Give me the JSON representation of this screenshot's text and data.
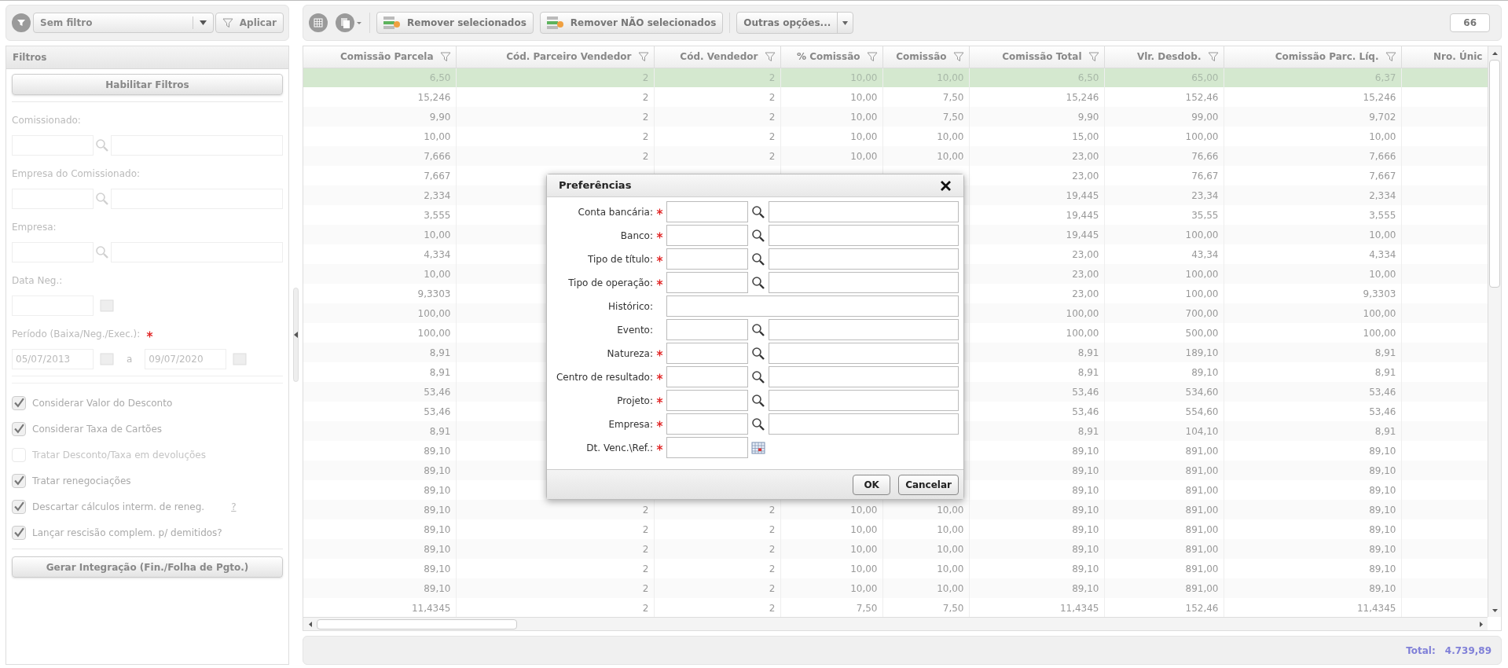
{
  "filter_bar": {
    "filter": "Sem filtro",
    "apply": "Aplicar"
  },
  "filters_panel": {
    "title": "Filtros",
    "enabled": false,
    "enable_button": "Habilitar Filtros",
    "fields": [
      {
        "label": "Comissionado:",
        "kind": "lookup"
      },
      {
        "label": "Empresa do Comissionado:",
        "kind": "lookup"
      },
      {
        "label": "Empresa:",
        "kind": "lookup"
      },
      {
        "label": "Data Neg.:",
        "kind": "date"
      },
      {
        "label": "Período (Baixa/Neg./Exec.):",
        "kind": "range",
        "required": true,
        "from": "05/07/2013",
        "separator": "a",
        "to": "09/07/2020"
      }
    ],
    "options": [
      {
        "label": "Considerar Valor do Desconto",
        "checked": true,
        "disabled": false
      },
      {
        "label": "Considerar Taxa de Cartões",
        "checked": true,
        "disabled": false
      },
      {
        "label": "Tratar Desconto/Taxa em devoluções",
        "checked": false,
        "disabled": true
      },
      {
        "label": "Tratar renegociações",
        "checked": true,
        "disabled": false
      },
      {
        "label": "Descartar cálculos interm. de reneg.",
        "checked": true,
        "disabled": false,
        "help": "?"
      },
      {
        "label": "Lançar rescisão complem. p/ demitidos?",
        "checked": true,
        "disabled": false
      }
    ],
    "action_button": "Gerar Integração (Fin./Folha de Pgto.)"
  },
  "toolbar": {
    "buttons": [
      "Remover selecionados",
      "Remover NÃO selecionados"
    ],
    "more": "Outras opções...",
    "count": "66"
  },
  "table": {
    "columns": [
      {
        "label": "Comissão Parcela",
        "filter": true
      },
      {
        "label": "Cód. Parceiro Vendedor",
        "filter": true
      },
      {
        "label": "Cód. Vendedor",
        "filter": true
      },
      {
        "label": "% Comissão",
        "filter": true
      },
      {
        "label": "Comissão",
        "filter": true
      },
      {
        "label": "Comissão Total",
        "filter": true
      },
      {
        "label": "Vlr. Desdob.",
        "filter": true
      },
      {
        "label": "Comissão Parc. Líq.",
        "filter": true
      },
      {
        "label": "Nro. Únic",
        "filter": false
      }
    ],
    "rows": [
      {
        "selected": true,
        "cells": [
          "6,50",
          "2",
          "2",
          "10,00",
          "10,00",
          "6,50",
          "65,00",
          "6,37",
          null
        ]
      },
      {
        "selected": false,
        "cells": [
          "15,246",
          "2",
          "2",
          "10,00",
          "7,50",
          "15,246",
          "152,46",
          "15,246",
          null
        ]
      },
      {
        "selected": false,
        "cells": [
          "9,90",
          "2",
          "2",
          "10,00",
          "7,50",
          "9,90",
          "99,00",
          "9,702",
          null
        ]
      },
      {
        "selected": false,
        "cells": [
          "10,00",
          "2",
          "2",
          "10,00",
          "10,00",
          "15,00",
          "100,00",
          "10,00",
          null
        ]
      },
      {
        "selected": false,
        "cells": [
          "7,666",
          "2",
          "2",
          "10,00",
          "10,00",
          "23,00",
          "76,66",
          "7,666",
          null
        ]
      },
      {
        "selected": false,
        "cells": [
          "7,667",
          null,
          null,
          null,
          null,
          "23,00",
          "76,67",
          "7,667",
          null
        ]
      },
      {
        "selected": false,
        "cells": [
          "2,334",
          null,
          null,
          null,
          null,
          "19,445",
          "23,34",
          "2,334",
          null
        ]
      },
      {
        "selected": false,
        "cells": [
          "3,555",
          null,
          null,
          null,
          null,
          "19,445",
          "35,55",
          "3,555",
          null
        ]
      },
      {
        "selected": false,
        "cells": [
          "10,00",
          null,
          null,
          null,
          null,
          "19,445",
          "100,00",
          "10,00",
          null
        ]
      },
      {
        "selected": false,
        "cells": [
          "4,334",
          null,
          null,
          null,
          null,
          "23,00",
          "43,34",
          "4,334",
          null
        ]
      },
      {
        "selected": false,
        "cells": [
          "10,00",
          null,
          null,
          null,
          null,
          "23,00",
          "100,00",
          "10,00",
          null
        ]
      },
      {
        "selected": false,
        "cells": [
          "9,3303",
          null,
          null,
          null,
          null,
          "23,00",
          "100,00",
          "9,3303",
          null
        ]
      },
      {
        "selected": false,
        "cells": [
          "100,00",
          null,
          null,
          null,
          null,
          "100,00",
          "700,00",
          "100,00",
          null
        ]
      },
      {
        "selected": false,
        "cells": [
          "100,00",
          null,
          null,
          null,
          null,
          "100,00",
          "500,00",
          "100,00",
          null
        ]
      },
      {
        "selected": false,
        "cells": [
          "8,91",
          null,
          null,
          null,
          null,
          "8,91",
          "189,10",
          "8,91",
          null
        ]
      },
      {
        "selected": false,
        "cells": [
          "8,91",
          null,
          null,
          null,
          null,
          "8,91",
          "89,10",
          "8,91",
          null
        ]
      },
      {
        "selected": false,
        "cells": [
          "53,46",
          null,
          null,
          null,
          null,
          "53,46",
          "534,60",
          "53,46",
          null
        ]
      },
      {
        "selected": false,
        "cells": [
          "53,46",
          null,
          null,
          null,
          null,
          "53,46",
          "554,60",
          "53,46",
          null
        ]
      },
      {
        "selected": false,
        "cells": [
          "8,91",
          null,
          null,
          null,
          null,
          "8,91",
          "104,10",
          "8,91",
          null
        ]
      },
      {
        "selected": false,
        "cells": [
          "89,10",
          null,
          null,
          null,
          null,
          "89,10",
          "891,00",
          "89,10",
          null
        ]
      },
      {
        "selected": false,
        "cells": [
          "89,10",
          null,
          null,
          null,
          null,
          "89,10",
          "891,00",
          "89,10",
          null
        ]
      },
      {
        "selected": false,
        "cells": [
          "89,10",
          null,
          null,
          null,
          null,
          "89,10",
          "891,00",
          "89,10",
          null
        ]
      },
      {
        "selected": false,
        "cells": [
          "89,10",
          "2",
          "2",
          "10,00",
          "10,00",
          "89,10",
          "891,00",
          "89,10",
          null
        ]
      },
      {
        "selected": false,
        "cells": [
          "89,10",
          "2",
          "2",
          "10,00",
          "10,00",
          "89,10",
          "891,00",
          "89,10",
          null
        ]
      },
      {
        "selected": false,
        "cells": [
          "89,10",
          "2",
          "2",
          "10,00",
          "10,00",
          "89,10",
          "891,00",
          "89,10",
          null
        ]
      },
      {
        "selected": false,
        "cells": [
          "89,10",
          "2",
          "2",
          "10,00",
          "10,00",
          "89,10",
          "891,00",
          "89,10",
          null
        ]
      },
      {
        "selected": false,
        "cells": [
          "89,10",
          "2",
          "2",
          "10,00",
          "10,00",
          "89,10",
          "891,00",
          "89,10",
          null
        ]
      },
      {
        "selected": false,
        "cells": [
          "11,4345",
          "2",
          "2",
          "7,50",
          "7,50",
          "11,4345",
          "152,46",
          "11,4345",
          null
        ]
      }
    ]
  },
  "footer": {
    "total_label": "Total:",
    "total_value": "4.739,89"
  },
  "dialog": {
    "title": "Preferências",
    "fields": [
      {
        "label": "Conta bancária:",
        "kind": "lookup",
        "required": true
      },
      {
        "label": "Banco:",
        "kind": "lookup",
        "required": true
      },
      {
        "label": "Tipo de título:",
        "kind": "lookup",
        "required": true
      },
      {
        "label": "Tipo de operação:",
        "kind": "lookup",
        "required": true
      },
      {
        "label": "Histórico:",
        "kind": "text",
        "required": false
      },
      {
        "label": "Evento:",
        "kind": "lookup",
        "required": false
      },
      {
        "label": "Natureza:",
        "kind": "lookup",
        "required": true
      },
      {
        "label": "Centro de resultado:",
        "kind": "lookup",
        "required": true
      },
      {
        "label": "Projeto:",
        "kind": "lookup",
        "required": true
      },
      {
        "label": "Empresa:",
        "kind": "lookup",
        "required": true
      },
      {
        "label": "Dt. Venc.\\Ref.:",
        "kind": "date",
        "required": true
      }
    ],
    "buttons": [
      "OK",
      "Cancelar"
    ]
  }
}
